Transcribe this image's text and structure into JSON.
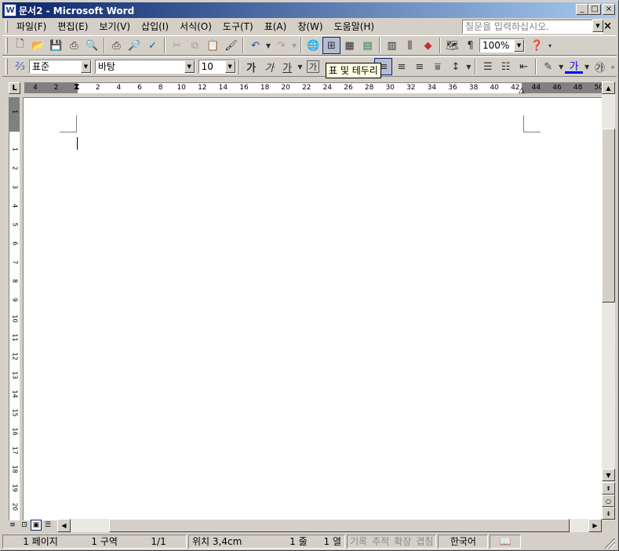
{
  "window": {
    "title": "문서2 - Microsoft Word",
    "icon": "word-app-icon",
    "buttons": {
      "minimize": "_",
      "maximize": "□",
      "close": "×"
    }
  },
  "menu": {
    "items": [
      "파일(F)",
      "편집(E)",
      "보기(V)",
      "삽입(I)",
      "서식(O)",
      "도구(T)",
      "표(A)",
      "창(W)",
      "도움말(H)"
    ],
    "help_placeholder": "질문을 입력하십시오.",
    "close_doc": "×"
  },
  "standard_toolbar": {
    "zoom": "100%",
    "icons": [
      "new-document-icon",
      "open-icon",
      "save-icon",
      "permission-icon",
      "print-preview-alt-icon",
      "print-icon",
      "print-preview-icon",
      "spelling-icon",
      "cut-icon",
      "copy-icon",
      "paste-icon",
      "format-painter-icon",
      "undo-icon",
      "redo-icon",
      "hyperlink-icon",
      "tables-and-borders-icon",
      "insert-table-icon",
      "insert-excel-icon",
      "columns-icon",
      "drawing-icon",
      "document-map-icon",
      "show-hide-icon",
      "help-icon"
    ]
  },
  "format_toolbar": {
    "style": "표준",
    "font": "바탕",
    "size": "10",
    "bold": "가",
    "italic": "가",
    "underline": "가",
    "char_border": "가",
    "font_color_label": "가"
  },
  "tooltip": "표 및 테두리",
  "ruler": {
    "horizontal_ticks": [
      "4",
      "2",
      "",
      "2",
      "4",
      "6",
      "8",
      "10",
      "12",
      "14",
      "16",
      "18",
      "20",
      "22",
      "24",
      "26",
      "28",
      "30",
      "32",
      "34",
      "36",
      "38",
      "40",
      "42",
      "44",
      "46",
      "48",
      "50"
    ],
    "vertical_ticks": [
      "1",
      "",
      "1",
      "2",
      "3",
      "4",
      "5",
      "6",
      "7",
      "8",
      "9",
      "10",
      "11",
      "12",
      "13",
      "14",
      "15",
      "16",
      "17",
      "18",
      "19",
      "20"
    ],
    "corner": "L"
  },
  "status": {
    "page": "1 페이지",
    "section": "1 구역",
    "page_of": "1/1",
    "position": "위치 3,4cm",
    "line": "1 줄",
    "column": "1 열",
    "rec": "기록",
    "trk": "추적",
    "ext": "확장",
    "ovr": "겹침",
    "language": "한국어"
  }
}
